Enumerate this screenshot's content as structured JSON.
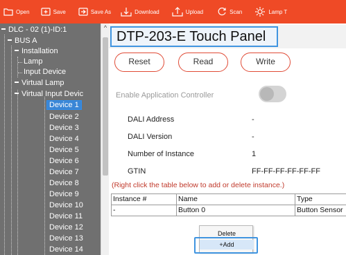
{
  "toolbar": {
    "open": "Open",
    "save": "Save",
    "save_as": "Save As",
    "download": "Download",
    "upload": "Upload",
    "scan": "Scan",
    "lamp_test": "Lamp T"
  },
  "tree": {
    "root": "DLC - 02 (1)-ID:1",
    "bus": "BUS A",
    "installation": "Installation",
    "lamp": "Lamp",
    "input_device": "Input Device",
    "virtual_lamp": "Virtual Lamp",
    "virtual_input": "Virtual Input Devic",
    "devices": [
      "Device 1",
      "Device 2",
      "Device 3",
      "Device 4",
      "Device 5",
      "Device 6",
      "Device 7",
      "Device 8",
      "Device 9",
      "Device 10",
      "Device 11",
      "Device 12",
      "Device 13",
      "Device 14"
    ]
  },
  "main": {
    "title": "DTP-203-E Touch Panel",
    "reset": "Reset",
    "read": "Read",
    "write": "Write",
    "enable_app_ctrl": "Enable Application Controller",
    "dali_address_label": "DALI Address",
    "dali_address_value": "-",
    "dali_version_label": "DALI Version",
    "dali_version_value": "-",
    "num_instance_label": "Number of Instance",
    "num_instance_value": "1",
    "gtin_label": "GTIN",
    "gtin_value": "FF-FF-FF-FF-FF-FF",
    "hint": "(Right click the table below to add or delete instance.)"
  },
  "table": {
    "headers": [
      "Instance #",
      "Name",
      "Type"
    ],
    "rows": [
      [
        "-",
        "Button 0",
        "Button Sensor"
      ]
    ]
  },
  "context_menu": {
    "delete": "Delete",
    "add": "+Add"
  },
  "colors": {
    "toolbar": "#ef4a26",
    "sidebar": "#707070",
    "highlight": "#3f94e0",
    "button_border": "#e04a35"
  }
}
